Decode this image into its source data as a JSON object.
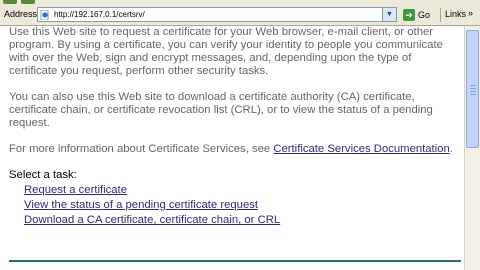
{
  "address_bar": {
    "label": "Address",
    "url": "http://192.167.0.1/certsrv/",
    "go_label": "Go",
    "links_label": "Links",
    "links_chevron": "»"
  },
  "content": {
    "para1": "Use this Web site to request a certificate for your Web browser, e-mail client, or other program. By using a certificate, you can verify your identity to people you communicate with over the Web, sign and encrypt messages, and, depending upon the type of certificate you request, perform other security tasks.",
    "para2": "You can also use this Web site to download a certificate authority (CA) certificate, certificate chain, or certificate revocation list (CRL), or to view the status of a pending request.",
    "para3_prefix": "For more information about Certificate Services, see ",
    "para3_link": "Certificate Services Documentation",
    "para3_suffix": ".",
    "task_heading": "Select a task:",
    "tasks": [
      "Request a certificate",
      "View the status of a pending certificate request",
      "Download a CA certificate, certificate chain, or CRL"
    ]
  },
  "icons": {
    "page_icon": "ie-page-icon",
    "dropdown": "dropdown-arrow-icon",
    "go": "go-arrow-icon"
  }
}
